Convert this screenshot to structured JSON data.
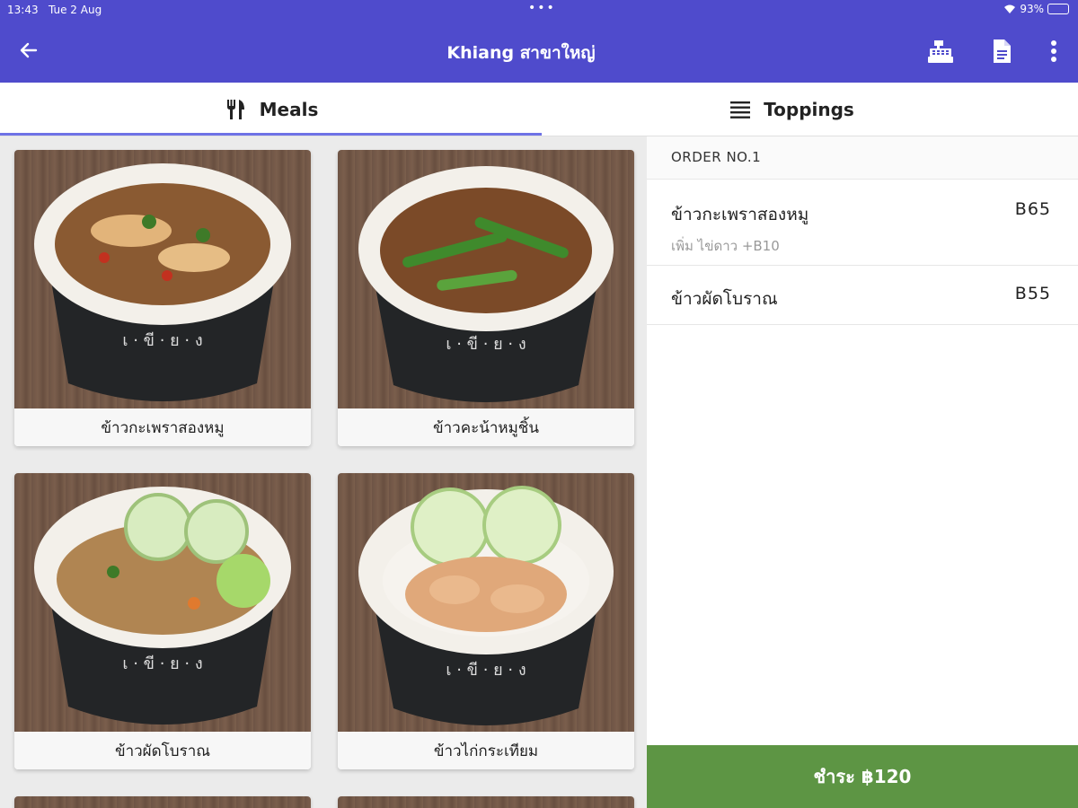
{
  "status_bar": {
    "time": "13:43",
    "date": "Tue 2 Aug",
    "battery": "93%",
    "battery_level": 0.93
  },
  "app_bar": {
    "title": "Khiang สาขาใหญ่",
    "back_icon": "arrow-left-icon",
    "actions": [
      "cash-register-icon",
      "receipt-document-icon",
      "more-vertical-icon"
    ]
  },
  "tabs": [
    {
      "label": "Meals",
      "icon": "fork-knife-icon",
      "selected": true
    },
    {
      "label": "Toppings",
      "icon": "menu-list-icon",
      "selected": false
    }
  ],
  "menu_items": [
    {
      "name": "ข้าวกะเพราสองหมู"
    },
    {
      "name": "ข้าวคะน้าหมูชิ้น"
    },
    {
      "name": "ข้าวผัดโบราณ"
    },
    {
      "name": "ข้าวไก่กระเทียม"
    }
  ],
  "order": {
    "title": "ORDER NO.1",
    "lines": [
      {
        "name": "ข้าวกะเพราสองหมู",
        "price": "B65",
        "note": "เพิ่ม ไข่ดาว +B10"
      },
      {
        "name": "ข้าวผัดโบราณ",
        "price": "B55"
      }
    ],
    "pay_label": "ชำระ ฿120"
  },
  "colors": {
    "app_bar": "#4f4bcc",
    "tab_indicator": "#6e72e6",
    "pay_button": "#5d9544"
  }
}
